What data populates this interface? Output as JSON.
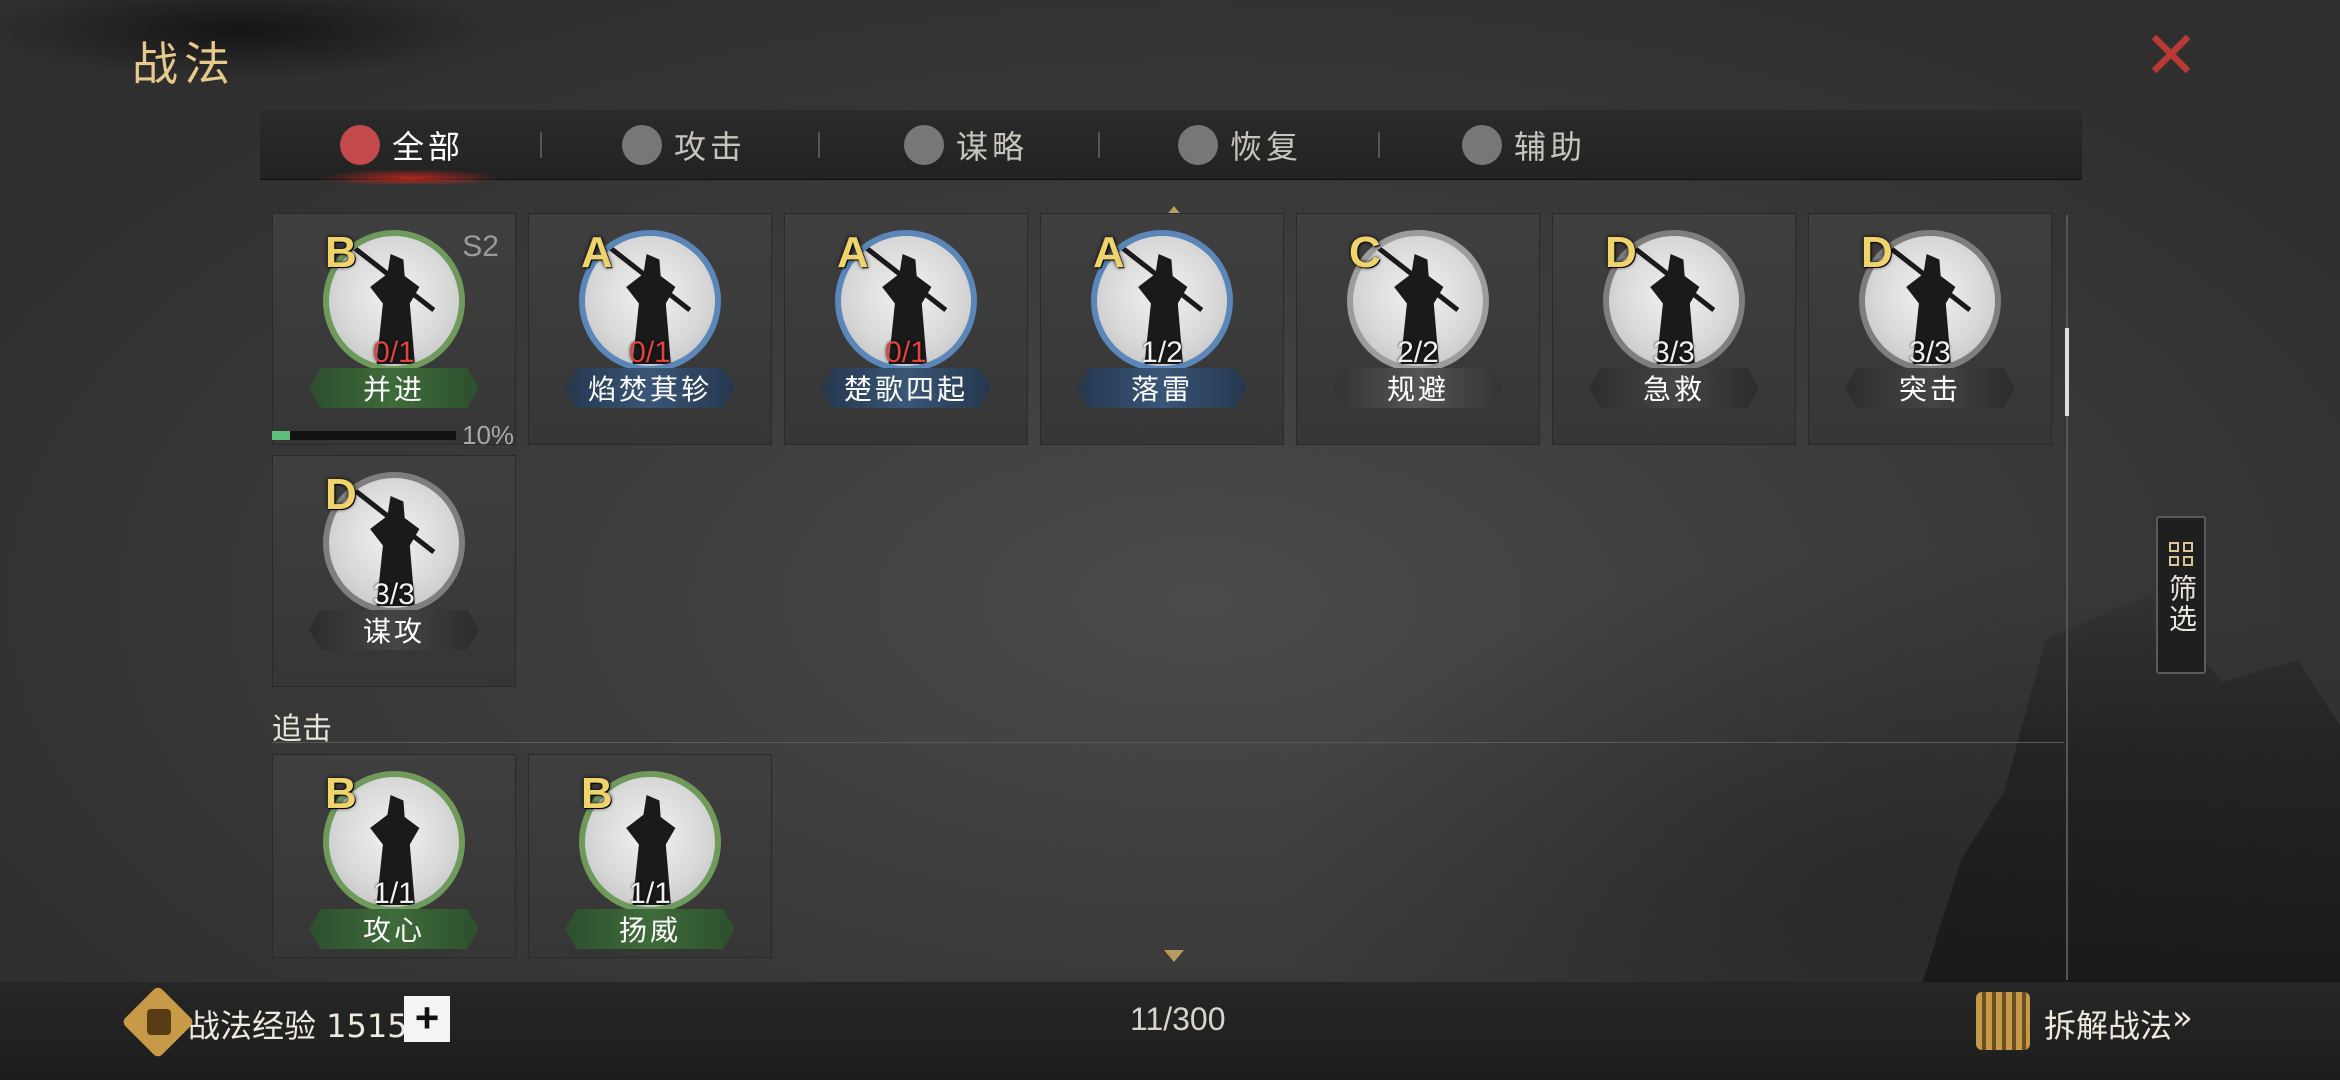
{
  "window": {
    "title": "战法"
  },
  "tabs": [
    {
      "label": "全部",
      "icon": "all-scrolls-icon",
      "active": true
    },
    {
      "label": "攻击",
      "icon": "crossed-swords-icon",
      "active": false
    },
    {
      "label": "谋略",
      "icon": "fan-icon",
      "active": false
    },
    {
      "label": "恢复",
      "icon": "healing-icon",
      "active": false
    },
    {
      "label": "辅助",
      "icon": "pouch-icon",
      "active": false
    }
  ],
  "cards": [
    {
      "grade": "B",
      "season": "S2",
      "count": "0/1",
      "name": "并进",
      "count_red": true
    },
    {
      "grade": "A",
      "count": "0/1",
      "name": "焰焚萁轸",
      "count_red": true
    },
    {
      "grade": "A",
      "count": "0/1",
      "name": "楚歌四起",
      "count_red": true
    },
    {
      "grade": "A",
      "count": "1/2",
      "name": "落雷",
      "count_red": false
    },
    {
      "grade": "C",
      "count": "2/2",
      "name": "规避",
      "count_red": false
    },
    {
      "grade": "D",
      "count": "3/3",
      "name": "急救",
      "count_red": false
    },
    {
      "grade": "D",
      "count": "3/3",
      "name": "突击",
      "count_red": false
    },
    {
      "grade": "D",
      "count": "3/3",
      "name": "谋攻",
      "count_red": false
    }
  ],
  "progress": {
    "value": 0.1,
    "label": "10%"
  },
  "section": {
    "label": "追击"
  },
  "pursuit_cards": [
    {
      "grade": "B",
      "count": "1/1",
      "name": "攻心"
    },
    {
      "grade": "B",
      "count": "1/1",
      "name": "扬威"
    }
  ],
  "filter": {
    "label": "筛选"
  },
  "footer": {
    "exp_label": "战法经验 1515",
    "plus": "+",
    "capacity": "11/300",
    "dismantle": "拆解战法",
    "dismantle_arrow": "»"
  },
  "colors": {
    "accent_gold": "#e7c98b",
    "close_red": "#b93a34",
    "count_red": "#e0453d",
    "progress_green": "#5fbf7a"
  }
}
